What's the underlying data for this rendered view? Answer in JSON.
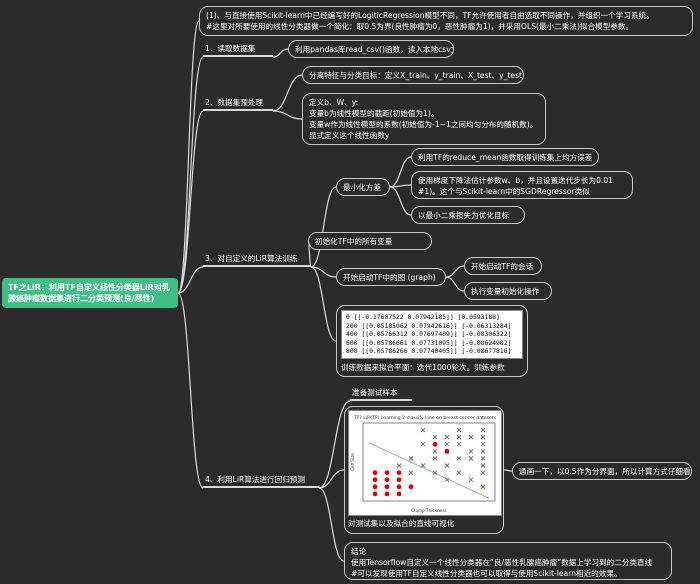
{
  "root": {
    "title": "TF之LiR：利用TF自定义线性分类器LiR对乳腺癌肿瘤数据集进行二分类预测(良/恶性)"
  },
  "branches": {
    "intro": [
      "(1)、与直接使用Scikit-learn中已经编写好的LogiticRegression模型不同，TF允许使用者自由选取不同操作，并组织一个学习系统。",
      "#这里对所要使用的线性分类器做一个简化：取0.5为界(良性肿瘤为0，恶性肿瘤为1)，并采用OLS(最小二乘法)拟合模型参数。"
    ],
    "b1": {
      "label": "1、读取数据集",
      "child": "利用pandas库read_csv()函数，读入本地csv文件"
    },
    "b2": {
      "label": "2、数据集预处理",
      "child1": "分离特征与分类目标：定义X_train、y_train、X_test、y_test",
      "child2": [
        "定义b、W、y:",
        "变量b为线性模型的截距(初始值为1)。",
        "变量w作为线性模型的系数(初始值为-1~1之间均匀分布的随机数)。",
        "显式定义这个线性函数y"
      ]
    },
    "b3": {
      "label": "3、对自定义的LiR算法训练",
      "min_label": "最小化方差",
      "min_children": [
        "利用TF的reduce_mean函数取得训练集上均方误差",
        [
          "使用梯度下降法估计参数w、b，并且设置迭代步长为0.01",
          "#1)。这个与Scikit-learn中的SGDRegressor类似"
        ],
        "以最小二乘损失为优化目标"
      ],
      "init_label": "初始化TF中的所有变量",
      "graph_label": "开始启动TF中的图 (graph)",
      "graph_children": [
        "开始启动TF的会话",
        "执行变量初始化操作"
      ],
      "log_lines": [
        "0  [[-0.17607522  0.07942185]] [0.0593188]",
        "200 [[0.05185062 0.07942616]] [-0.06313284]",
        "400 [[0.05766312 0.07697409]] [-0.08306322]",
        "600 [[0.05786661 0.07731095]] [-0.08624902]",
        "800 [[0.05786266 0.07740405]] [-0.08677816]"
      ],
      "log_caption": "训练数据来拟合平面：迭代1000轮次。训练参数"
    },
    "b4": {
      "label": "4、利用LiR算法进行回归预测",
      "prep": "准备测试样本",
      "img_title": "TF? LiR(TF)  Learning 2-classify Line on breast cancer datasets",
      "img_caption": "对测试集以及拟合的直线可视化",
      "side_note": "通画一下，以0.5作为分界面，所以计算方式仔细看",
      "img_xlabel": "Clump Thickness",
      "img_ylabel": "Cell Size",
      "conclusion": [
        "结论",
        "使用Tensorflow自定义一个线性分类器在“良/恶性乳腺癌肿瘤”数据上学习到的二分类直线",
        "#可以发现使用TF自定义线性分类器也可以取得与使用Scikit-learn相近的效果。"
      ]
    }
  },
  "colors": {
    "root_fill": "#3fbf86",
    "line": "#d9d9d9",
    "background": "#2b2b2b",
    "benign": "#555555",
    "malignant": "#e00000",
    "fit_line": "#7fbf7f"
  },
  "scatter": {
    "benign_points": [
      [
        6,
        9
      ],
      [
        7,
        9
      ],
      [
        8,
        9
      ],
      [
        9,
        9
      ],
      [
        10,
        9
      ],
      [
        5,
        8
      ],
      [
        7,
        8
      ],
      [
        8,
        8
      ],
      [
        10,
        8
      ],
      [
        6,
        7
      ],
      [
        7,
        7
      ],
      [
        9,
        7
      ],
      [
        10,
        7
      ],
      [
        4,
        6
      ],
      [
        6,
        6
      ],
      [
        8,
        6
      ],
      [
        9,
        6
      ],
      [
        10,
        6
      ],
      [
        5,
        5
      ],
      [
        7,
        5
      ],
      [
        10,
        5
      ],
      [
        6,
        4
      ],
      [
        8,
        4
      ],
      [
        10,
        4
      ],
      [
        10,
        10
      ],
      [
        8,
        10
      ],
      [
        5,
        10
      ],
      [
        3,
        5
      ],
      [
        4,
        4
      ],
      [
        9,
        3
      ],
      [
        7,
        3
      ],
      [
        10,
        2
      ]
    ],
    "malignant_points": [
      [
        6,
        8
      ],
      [
        7,
        7
      ],
      [
        1,
        4
      ],
      [
        2,
        4
      ],
      [
        3,
        4
      ],
      [
        1,
        3
      ],
      [
        2,
        3
      ],
      [
        3,
        3
      ],
      [
        1,
        2
      ],
      [
        2,
        2
      ],
      [
        3,
        2
      ],
      [
        1,
        1
      ],
      [
        2,
        1
      ],
      [
        3,
        1
      ],
      [
        4,
        2
      ]
    ],
    "xlim": [
      0,
      11
    ],
    "ylim": [
      0,
      11
    ]
  }
}
